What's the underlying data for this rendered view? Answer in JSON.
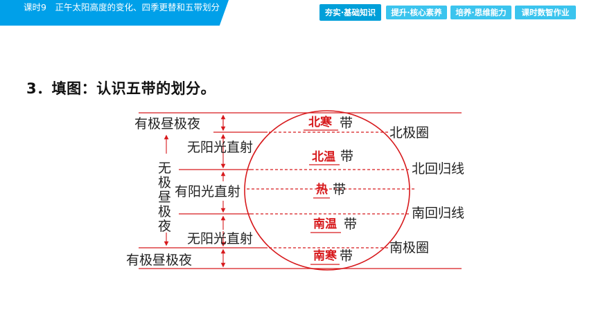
{
  "header": {
    "lesson_title": "课时9　正午太阳高度的变化、四季更替和五带划分",
    "tabs": [
      {
        "label": "夯实·基础知识",
        "active": true
      },
      {
        "label": "提升·核心素养",
        "active": false
      },
      {
        "label": "培养·思维能力",
        "active": false
      },
      {
        "label": "课时数智作业",
        "active": false
      }
    ]
  },
  "question": {
    "title": "3．填图：认识五带的划分。"
  },
  "diagram": {
    "left_labels": {
      "top_night_day": "有极昼极夜",
      "upper_no_direct": "无阳光直射",
      "vertical_no_polar": [
        "无",
        "极",
        "昼",
        "极",
        "夜"
      ],
      "direct_sun": "有阳光直射",
      "lower_no_direct": "无阳光直射",
      "bottom_night_day": "有极昼极夜"
    },
    "right_labels": {
      "arctic_circle": "北极圈",
      "tropic_cancer": "北回归线",
      "tropic_capricorn": "南回归线",
      "antarctic_circle": "南极圈"
    },
    "zone_suffix": "带",
    "answers": {
      "north_frigid": "北寒",
      "north_temperate": "北温",
      "tropical": "热",
      "south_temperate": "南温",
      "south_frigid": "南寒"
    },
    "colors": {
      "outline": "#d7191c",
      "answer_text": "#d7191c",
      "label_text": "#222222"
    }
  }
}
